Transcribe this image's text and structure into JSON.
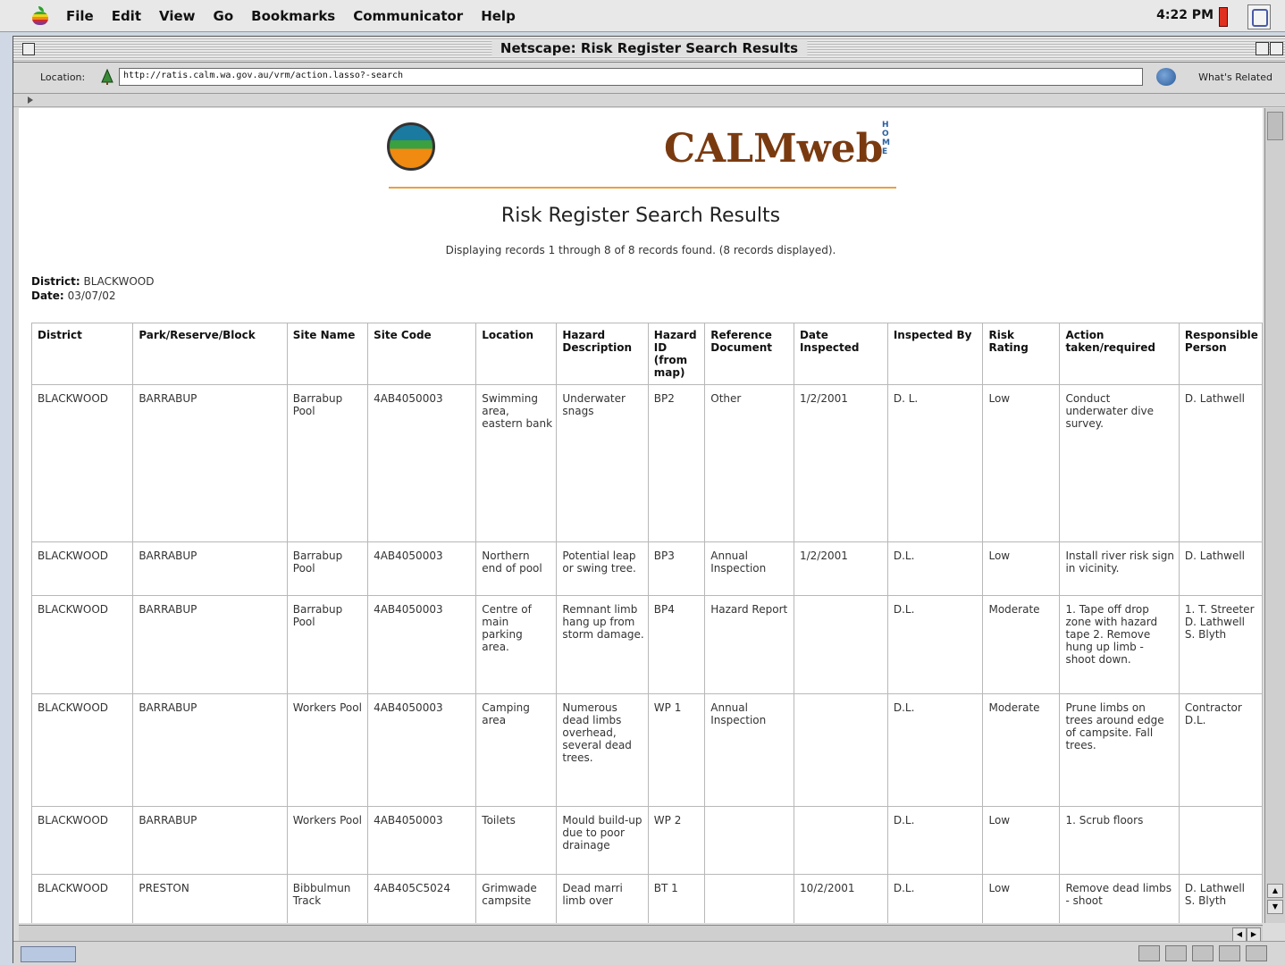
{
  "menubar": {
    "items": [
      "File",
      "Edit",
      "View",
      "Go",
      "Bookmarks",
      "Communicator",
      "Help"
    ],
    "clock": "4:22 PM"
  },
  "window": {
    "title": "Netscape: Risk Register Search Results",
    "location_label": "Location:",
    "location_url": "http://ratis.calm.wa.gov.au/vrm/action.lasso?-search",
    "related_label": "What's Related"
  },
  "page": {
    "logo_text": "CALMweb",
    "home_text": "HOME",
    "title": "Risk Register Search Results",
    "record_note": "Displaying records 1 through 8 of 8 records found. (8 records displayed).",
    "district_label": "District:",
    "district_value": "BLACKWOOD",
    "date_label": "Date:",
    "date_value": "03/07/02"
  },
  "table": {
    "headers": [
      "District",
      "Park/Reserve/Block",
      "Site Name",
      "Site Code",
      "Location",
      "Hazard Description",
      "Hazard ID (from map)",
      "Reference Document",
      "Date Inspected",
      "Inspected By",
      "Risk Rating",
      "Action taken/required",
      "Responsible Person"
    ],
    "rows": [
      [
        "BLACKWOOD",
        "BARRABUP",
        "Barrabup Pool",
        "4AB4050003",
        "Swimming area, eastern bank",
        "Underwater snags",
        "BP2",
        "Other",
        "1/2/2001",
        "D. L.",
        "Low",
        "Conduct underwater dive survey.",
        "D. Lathwell"
      ],
      [
        "BLACKWOOD",
        "BARRABUP",
        "Barrabup Pool",
        "4AB4050003",
        "Northern end of pool",
        "Potential leap or swing tree.",
        "BP3",
        "Annual Inspection",
        "1/2/2001",
        "D.L.",
        "Low",
        "Install river risk sign in vicinity.",
        "D. Lathwell"
      ],
      [
        "BLACKWOOD",
        "BARRABUP",
        "Barrabup Pool",
        "4AB4050003",
        "Centre of main parking area.",
        "Remnant limb hang up from storm damage.",
        "BP4",
        "Hazard Report",
        "",
        "D.L.",
        "Moderate",
        "1. Tape off drop zone with hazard tape 2. Remove hung up limb - shoot down.",
        "1. T. Streeter D. Lathwell S. Blyth"
      ],
      [
        "BLACKWOOD",
        "BARRABUP",
        "Workers Pool",
        "4AB4050003",
        "Camping area",
        "Numerous dead limbs overhead, several dead trees.",
        "WP 1",
        "Annual Inspection",
        "",
        "D.L.",
        "Moderate",
        "Prune limbs on trees around edge of campsite. Fall trees.",
        "Contractor D.L."
      ],
      [
        "BLACKWOOD",
        "BARRABUP",
        "Workers Pool",
        "4AB4050003",
        "Toilets",
        "Mould build-up due to poor drainage",
        "WP 2",
        "",
        "",
        "D.L.",
        "Low",
        "1. Scrub floors",
        ""
      ],
      [
        "BLACKWOOD",
        "PRESTON",
        "Bibbulmun Track",
        "4AB405C5024",
        "Grimwade campsite",
        "Dead marri limb over",
        "BT 1",
        "",
        "10/2/2001",
        "D.L.",
        "Low",
        "Remove dead limbs - shoot",
        "D. Lathwell S. Blyth"
      ]
    ]
  }
}
